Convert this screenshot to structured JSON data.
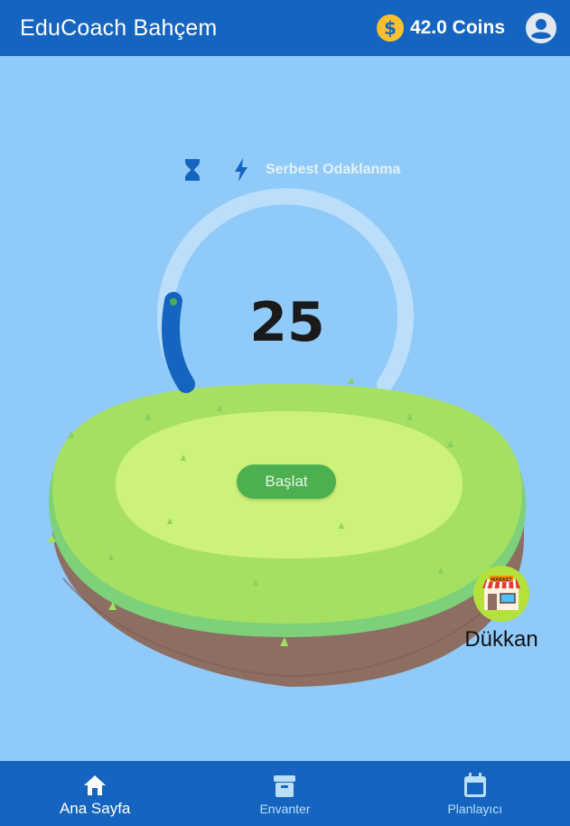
{
  "app": {
    "title": "EduCoach Bahçem"
  },
  "header": {
    "coins_label": "42.0 Coins",
    "coin_icon": "dollar-coin-icon",
    "profile_icon": "account-circle-icon"
  },
  "mode": {
    "timer_icon": "hourglass-icon",
    "mode_icon": "lightning-bolt-icon",
    "label": "Serbest Odaklanma"
  },
  "timer": {
    "value": "25",
    "progress_fraction": 0.12
  },
  "start_button": {
    "label": "Başlat"
  },
  "shop": {
    "label": "Dükkan",
    "icon": "market-store-icon",
    "sign_text": "MARKET"
  },
  "bottom_nav": {
    "items": [
      {
        "label": "Ana Sayfa",
        "icon": "home-icon",
        "active": true
      },
      {
        "label": "Envanter",
        "icon": "archive-box-icon",
        "active": false
      },
      {
        "label": "Planlayıcı",
        "icon": "calendar-icon",
        "active": false
      }
    ]
  },
  "colors": {
    "primary": "#1565c0",
    "background": "#90caf9",
    "coin": "#fbc02d",
    "grass": "#a5e062",
    "start_button": "#4caf50"
  }
}
